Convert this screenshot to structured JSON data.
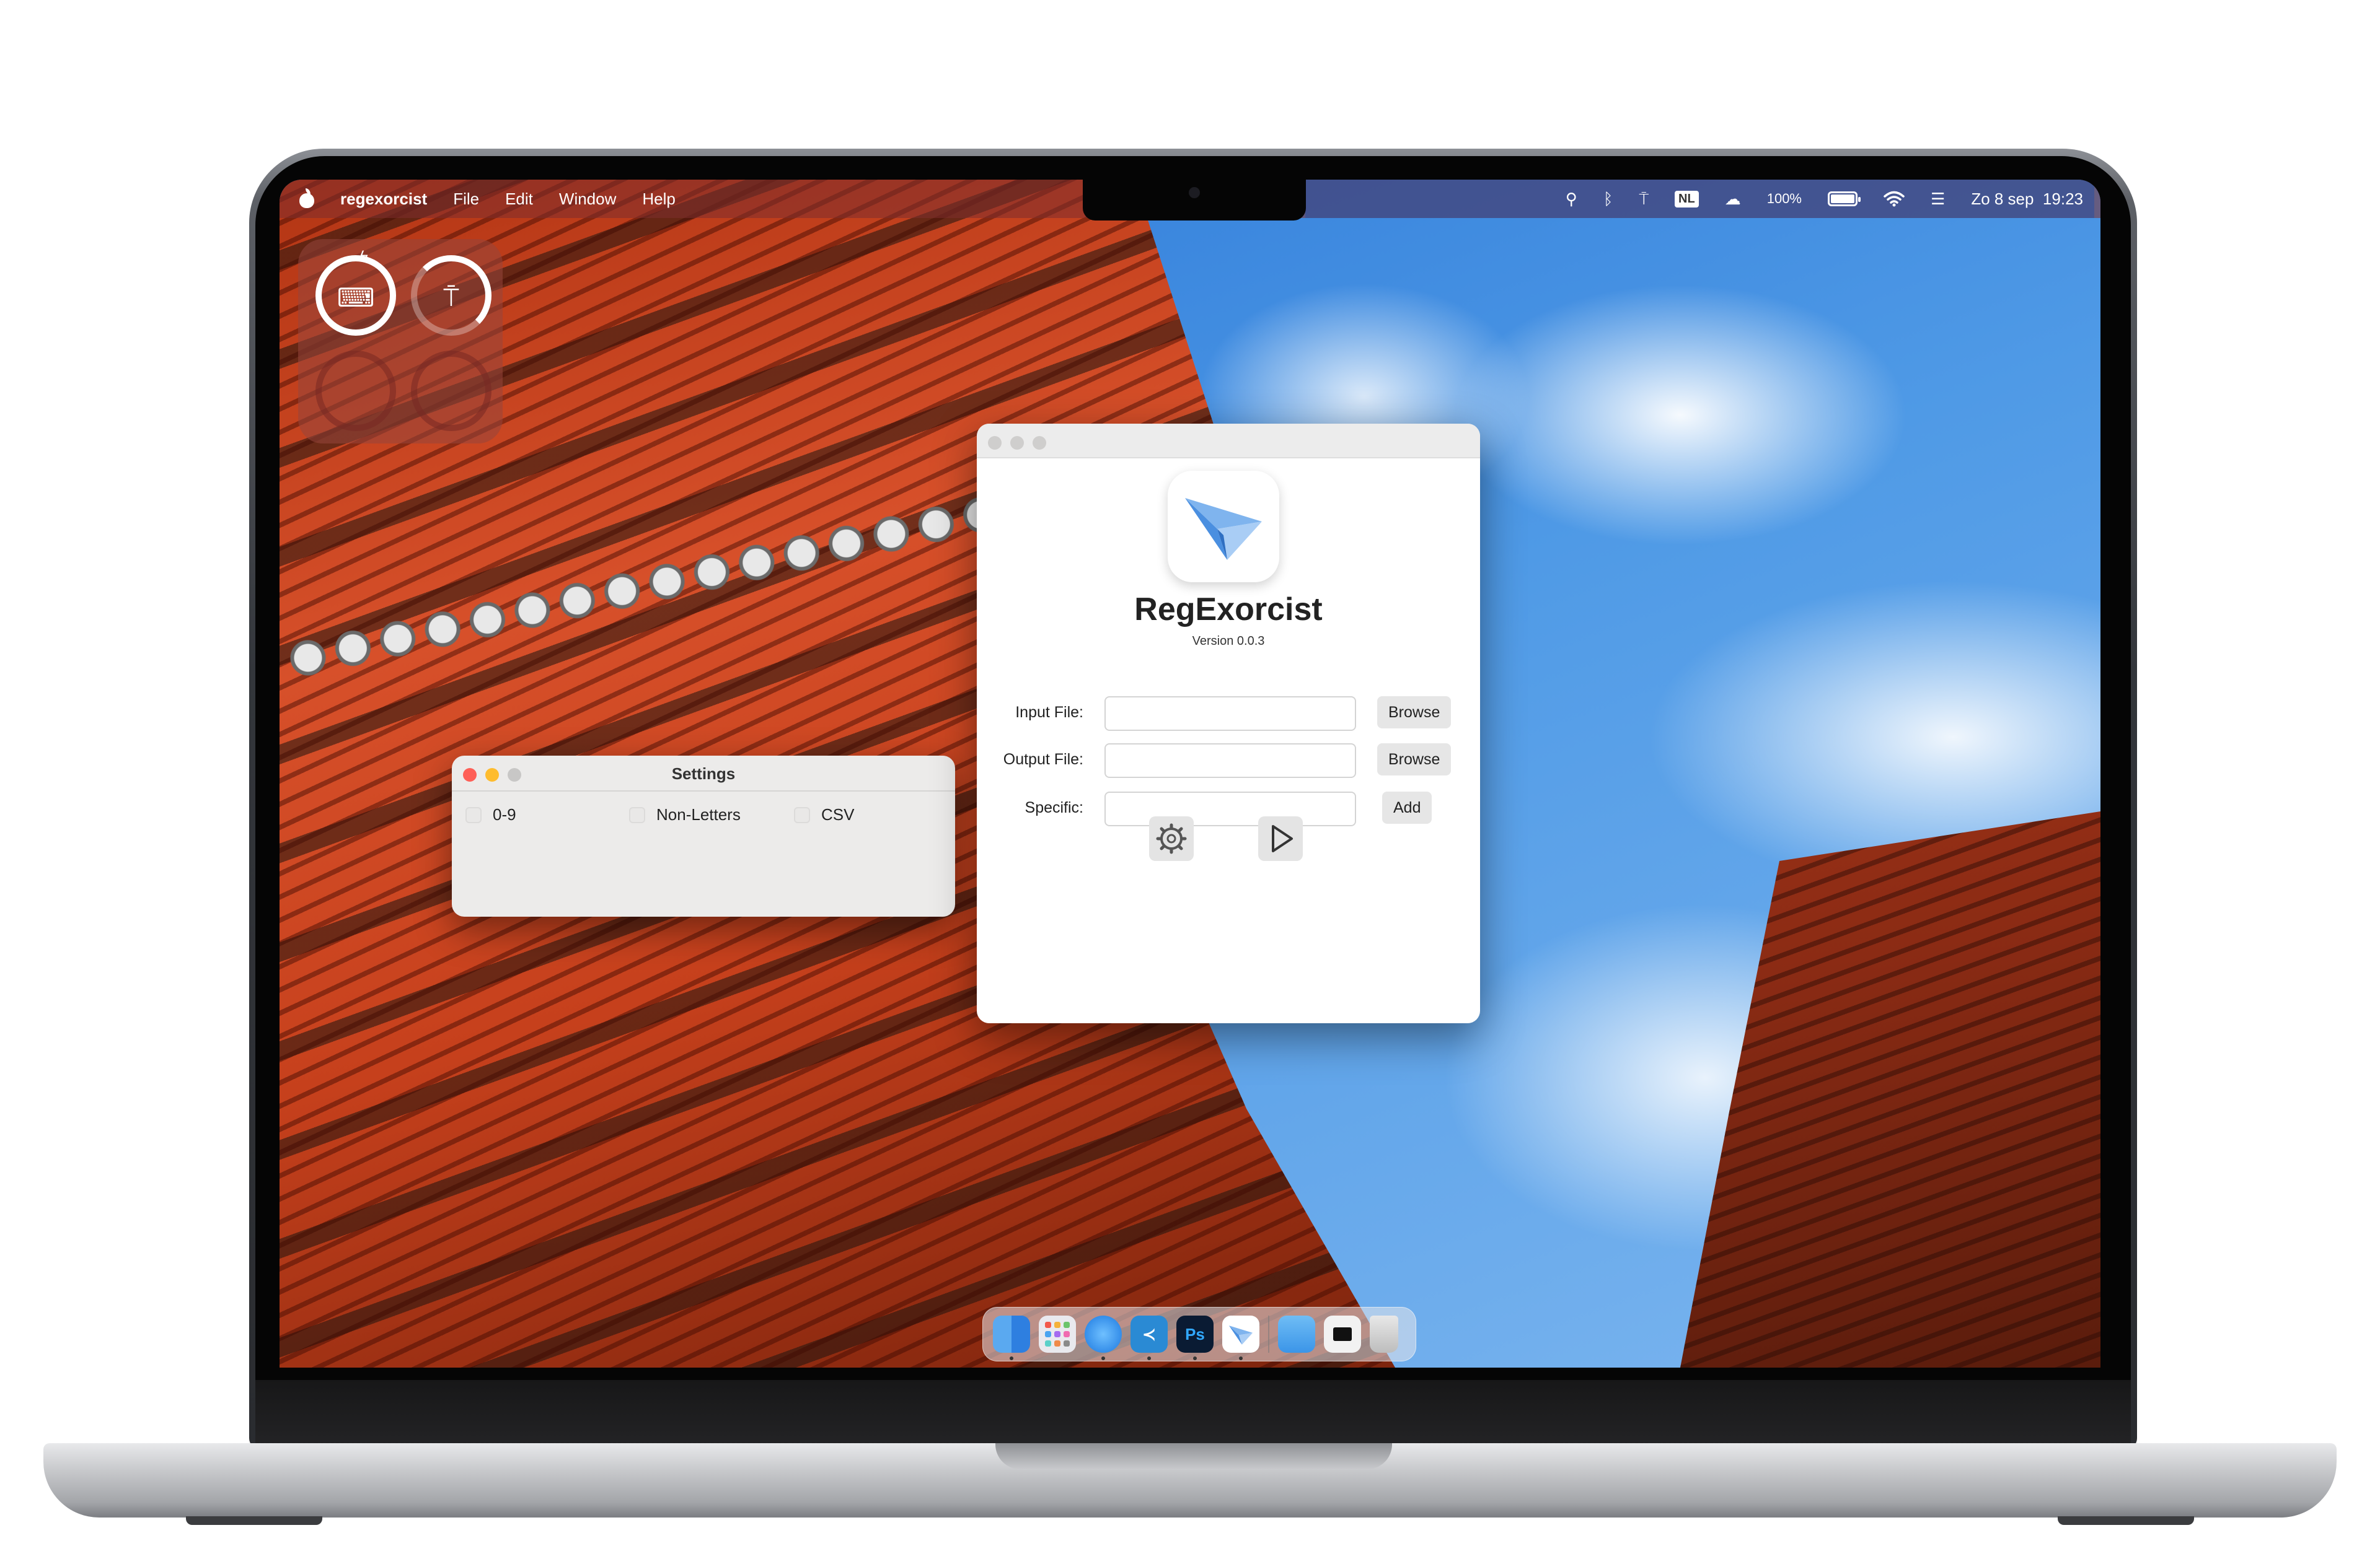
{
  "menubar": {
    "app_name": "regexorcist",
    "menus": [
      "File",
      "Edit",
      "Window",
      "Help"
    ],
    "input_source": "NL",
    "battery_percent": "100%",
    "datetime": "Zo 8 sep  19:23"
  },
  "settings_window": {
    "title": "Settings",
    "options": [
      {
        "label": "0-9",
        "checked": false
      },
      {
        "label": "Non-Letters",
        "checked": false
      },
      {
        "label": "CSV",
        "checked": false
      }
    ]
  },
  "main_window": {
    "app_title": "RegExorcist",
    "version": "Version 0.0.3",
    "input_file": {
      "label": "Input File:",
      "value": "",
      "button": "Browse"
    },
    "output_file": {
      "label": "Output File:",
      "value": "",
      "button": "Browse"
    },
    "specific": {
      "label": "Specific:",
      "value": "",
      "button": "Add"
    },
    "settings_icon": "gear-icon",
    "run_icon": "play-icon"
  },
  "dock": {
    "apps": [
      "Finder",
      "Launchpad",
      "Safari",
      "Visual Studio Code",
      "Photoshop",
      "RegExorcist",
      "Downloads",
      "Terminal",
      "Trash"
    ]
  },
  "colors": {
    "close": "#fe5f57",
    "minimize": "#febc2e",
    "sky": "#4f9ae6",
    "temple": "#c6401c"
  }
}
